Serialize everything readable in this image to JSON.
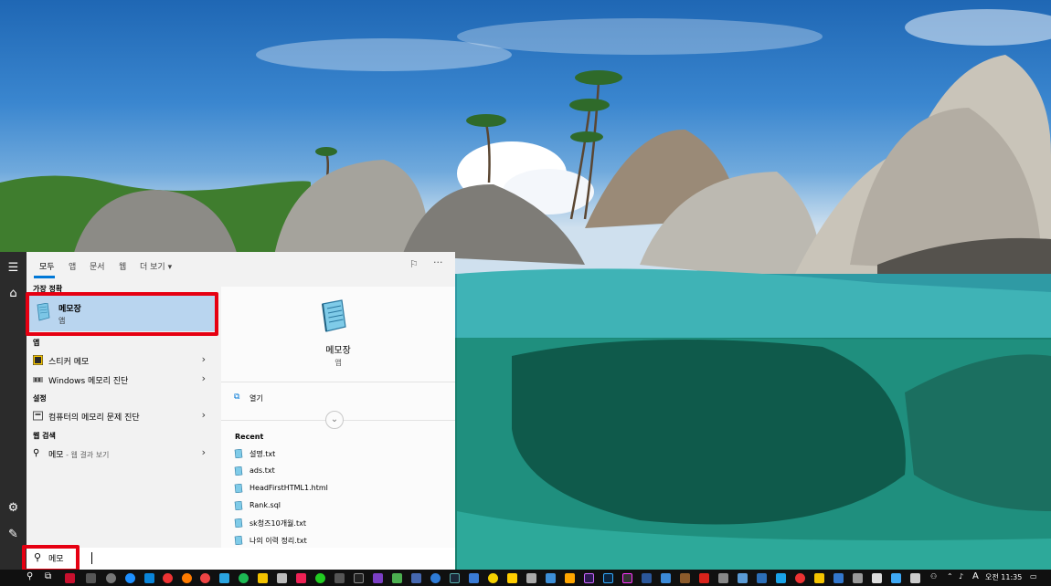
{
  "start_menu": {
    "tabs": [
      "모두",
      "앱",
      "문서",
      "웹",
      "더 보기"
    ],
    "more_caret": "▾",
    "best_match": {
      "heading": "가장 정확",
      "title": "메모장",
      "subtitle": "앱"
    },
    "apps": {
      "heading": "앱",
      "items": [
        {
          "label": "스티커 메모"
        },
        {
          "label": "Windows 메모리 진단"
        }
      ]
    },
    "settings": {
      "heading": "설정",
      "items": [
        {
          "label": "컴퓨터의 메모리 문제 진단"
        }
      ]
    },
    "web": {
      "heading": "웹 검색",
      "item": {
        "label": "메모",
        "suffix": " - 웹 결과 보기"
      }
    },
    "preview": {
      "title": "메모장",
      "subtitle": "앱",
      "open_label": "열기",
      "recent_heading": "Recent",
      "recent": [
        "설명.txt",
        "ads.txt",
        "HeadFirstHTML1.html",
        "Rank.sql",
        "sk청즈10개월.txt",
        "나의 이력 정리.txt"
      ]
    },
    "search": {
      "query": "메모"
    },
    "chevron": "›"
  },
  "taskbar": {
    "language": "A",
    "clock": "오전 11:35",
    "icons": [
      "search-icon",
      "task-view-icon",
      "app-icons"
    ]
  },
  "colors": {
    "accent": "#0078d7",
    "highlight_box": "#e60012",
    "selected_row": "#b9d5ef"
  }
}
